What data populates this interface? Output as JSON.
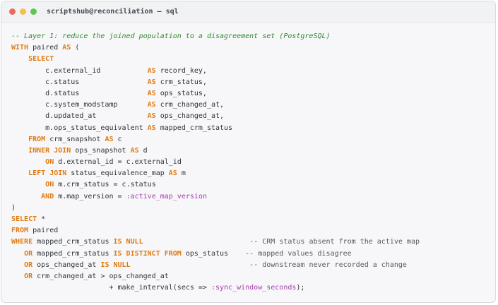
{
  "window": {
    "title": "scriptshub@reconciliation — sql",
    "controls": [
      {
        "name": "close",
        "color": "#ed6a5e"
      },
      {
        "name": "minimize",
        "color": "#f5bf4f"
      },
      {
        "name": "maximize",
        "color": "#61c554"
      }
    ]
  },
  "colors": {
    "keyword": "#e07b12",
    "comment": "#2e8b2e",
    "parameter": "#a33ea8",
    "text": "#2f3337"
  },
  "code": {
    "lines": [
      [
        {
          "t": "-- Layer 1: reduce the joined population to a disagreement set (PostgreSQL)",
          "k": "cm"
        }
      ],
      [
        {
          "t": "WITH",
          "k": "kw"
        },
        {
          "t": " paired "
        },
        {
          "t": "AS",
          "k": "kw"
        },
        {
          "t": " ("
        }
      ],
      [
        {
          "t": "    "
        },
        {
          "t": "SELECT",
          "k": "kw"
        }
      ],
      [
        {
          "t": "        c.external_id           "
        },
        {
          "t": "AS",
          "k": "kw"
        },
        {
          "t": " record_key,"
        }
      ],
      [
        {
          "t": "        c.status                "
        },
        {
          "t": "AS",
          "k": "kw"
        },
        {
          "t": " crm_status,"
        }
      ],
      [
        {
          "t": "        d.status                "
        },
        {
          "t": "AS",
          "k": "kw"
        },
        {
          "t": " ops_status,"
        }
      ],
      [
        {
          "t": "        c.system_modstamp       "
        },
        {
          "t": "AS",
          "k": "kw"
        },
        {
          "t": " crm_changed_at,"
        }
      ],
      [
        {
          "t": "        d.updated_at            "
        },
        {
          "t": "AS",
          "k": "kw"
        },
        {
          "t": " ops_changed_at,"
        }
      ],
      [
        {
          "t": "        m.ops_status_equivalent "
        },
        {
          "t": "AS",
          "k": "kw"
        },
        {
          "t": " mapped_crm_status"
        }
      ],
      [
        {
          "t": "    "
        },
        {
          "t": "FROM",
          "k": "kw"
        },
        {
          "t": " crm_snapshot "
        },
        {
          "t": "AS",
          "k": "kw"
        },
        {
          "t": " c"
        }
      ],
      [
        {
          "t": "    "
        },
        {
          "t": "INNER JOIN",
          "k": "kw"
        },
        {
          "t": " ops_snapshot "
        },
        {
          "t": "AS",
          "k": "kw"
        },
        {
          "t": " d"
        }
      ],
      [
        {
          "t": "        "
        },
        {
          "t": "ON",
          "k": "kw"
        },
        {
          "t": " d.external_id = c.external_id"
        }
      ],
      [
        {
          "t": "    "
        },
        {
          "t": "LEFT JOIN",
          "k": "kw"
        },
        {
          "t": " status_equivalence_map "
        },
        {
          "t": "AS",
          "k": "kw"
        },
        {
          "t": " m"
        }
      ],
      [
        {
          "t": "        "
        },
        {
          "t": "ON",
          "k": "kw"
        },
        {
          "t": " m.crm_status = c.status"
        }
      ],
      [
        {
          "t": "       "
        },
        {
          "t": "AND",
          "k": "kw"
        },
        {
          "t": " m.map_version = "
        },
        {
          "t": ":active_map_version",
          "k": "prm"
        }
      ],
      [
        {
          "t": ")"
        }
      ],
      [
        {
          "t": "SELECT",
          "k": "kw"
        },
        {
          "t": " *"
        }
      ],
      [
        {
          "t": "FROM",
          "k": "kw"
        },
        {
          "t": " paired"
        }
      ],
      [
        {
          "t": "WHERE",
          "k": "kw"
        },
        {
          "t": " mapped_crm_status "
        },
        {
          "t": "IS NULL",
          "k": "kw"
        },
        {
          "t": "                         "
        },
        {
          "t": "-- CRM status absent from the active map",
          "k": "cmi"
        }
      ],
      [
        {
          "t": "   "
        },
        {
          "t": "OR",
          "k": "kw"
        },
        {
          "t": " mapped_crm_status "
        },
        {
          "t": "IS DISTINCT FROM",
          "k": "kw"
        },
        {
          "t": " ops_status    "
        },
        {
          "t": "-- mapped values disagree",
          "k": "cmi"
        }
      ],
      [
        {
          "t": "   "
        },
        {
          "t": "OR",
          "k": "kw"
        },
        {
          "t": " ops_changed_at "
        },
        {
          "t": "IS NULL",
          "k": "kw"
        },
        {
          "t": "                            "
        },
        {
          "t": "-- downstream never recorded a change",
          "k": "cmi"
        }
      ],
      [
        {
          "t": "   "
        },
        {
          "t": "OR",
          "k": "kw"
        },
        {
          "t": " crm_changed_at > ops_changed_at"
        }
      ],
      [
        {
          "t": "                       + make_interval(secs => "
        },
        {
          "t": ":sync_window_seconds",
          "k": "prm"
        },
        {
          "t": ");"
        }
      ]
    ]
  }
}
